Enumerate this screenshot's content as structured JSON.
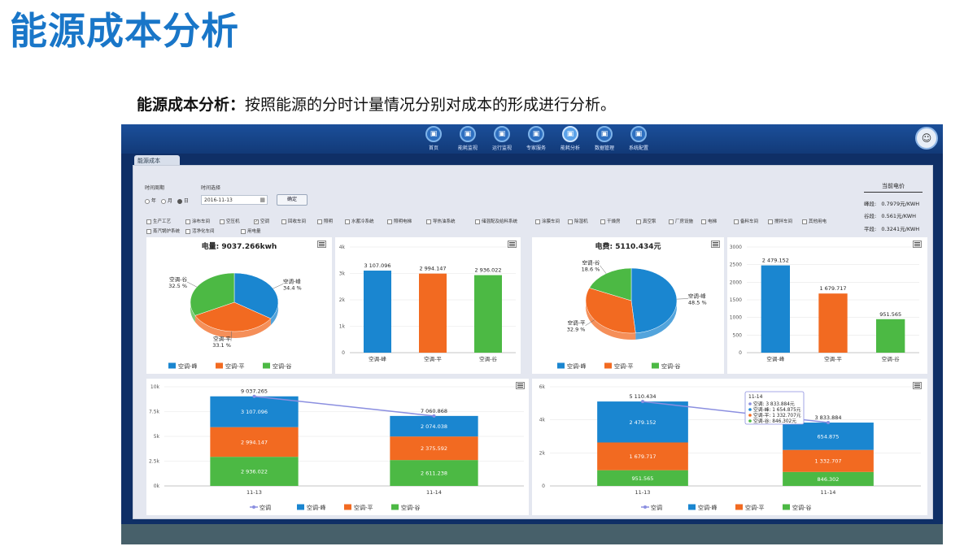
{
  "slide": {
    "title": "能源成本分析",
    "subtitle_bold": "能源成本分析",
    "subtitle_colon": "：",
    "subtitle_rest": "按照能源的分时计量情况分别对成本的形成进行分析。"
  },
  "nav": {
    "items": [
      {
        "label": "首页",
        "icon": "home-icon"
      },
      {
        "label": "能耗监视",
        "icon": "bar-chart-icon"
      },
      {
        "label": "运行监视",
        "icon": "gauge-icon"
      },
      {
        "label": "专家服务",
        "icon": "document-icon"
      },
      {
        "label": "能耗分析",
        "icon": "analysis-icon"
      },
      {
        "label": "数据管理",
        "icon": "data-icon"
      },
      {
        "label": "系统配置",
        "icon": "network-icon"
      }
    ],
    "active_index": 4
  },
  "tab": {
    "label": "能源成本"
  },
  "filters": {
    "period_label": "时间周期",
    "period_options": [
      "年",
      "月",
      "日"
    ],
    "period_selected": "日",
    "date_label": "时间选择",
    "date_value": "2016-11-13",
    "confirm_label": "确定"
  },
  "checkboxes": [
    {
      "label": "生产工艺",
      "checked": false
    },
    {
      "label": "涂布车间",
      "checked": false
    },
    {
      "label": "空压机",
      "checked": false
    },
    {
      "label": "空调",
      "checked": true
    },
    {
      "label": "回收车间",
      "checked": false
    },
    {
      "label": "照明",
      "checked": false
    },
    {
      "label": "水蓄冷系统",
      "checked": false
    },
    {
      "label": "照明电梯",
      "checked": false
    },
    {
      "label": "导热油系统",
      "checked": false
    },
    {
      "label": "储混配及给料系统",
      "checked": false
    },
    {
      "label": "涂膜车间",
      "checked": false
    },
    {
      "label": "除湿机",
      "checked": false
    },
    {
      "label": "干燥房",
      "checked": false
    },
    {
      "label": "真空泵",
      "checked": false
    },
    {
      "label": "厂房设施",
      "checked": false
    },
    {
      "label": "电梯",
      "checked": false
    },
    {
      "label": "备料车间",
      "checked": false
    },
    {
      "label": "搅拌车间",
      "checked": false
    },
    {
      "label": "其他用电",
      "checked": false
    },
    {
      "label": "蒸汽锅炉系统",
      "checked": false
    },
    {
      "label": "活净化车间",
      "checked": false
    },
    {
      "label": "用电量",
      "checked": false
    }
  ],
  "price": {
    "title": "当前电价",
    "rows": [
      {
        "label": "峰段:",
        "value": "0.7979元/KWH"
      },
      {
        "label": "谷段:",
        "value": "0.561元/KWH"
      },
      {
        "label": "平段:",
        "value": "0.3241元/KWH"
      }
    ]
  },
  "colors": {
    "peak": "#1a86d0",
    "flat": "#f26a21",
    "valley": "#4cb944",
    "line": "#8b8fe0"
  },
  "chart_data": [
    {
      "type": "pie",
      "title": "电量: 9037.266kwh",
      "slices": [
        {
          "name": "空调-峰",
          "value": 34.4,
          "label": "34.4 %"
        },
        {
          "name": "空调-平",
          "value": 33.1,
          "label": "33.1 %"
        },
        {
          "name": "空调-谷",
          "value": 32.5,
          "label": "32.5 %"
        }
      ],
      "legend": [
        "空调-峰",
        "空调-平",
        "空调-谷"
      ]
    },
    {
      "type": "bar",
      "categories": [
        "空调-峰",
        "空调-平",
        "空调-谷"
      ],
      "values": [
        3107.096,
        2994.147,
        2936.022
      ],
      "value_labels": [
        "3 107.096",
        "2 994.147",
        "2 936.022"
      ],
      "yticks": [
        "0",
        "1k",
        "2k",
        "3k",
        "4k"
      ],
      "ylim": [
        0,
        4000
      ]
    },
    {
      "type": "pie",
      "title": "电费: 5110.434元",
      "slices": [
        {
          "name": "空调-峰",
          "value": 48.5,
          "label": "48.5 %"
        },
        {
          "name": "空调-平",
          "value": 32.9,
          "label": "32.9 %"
        },
        {
          "name": "空调-谷",
          "value": 18.6,
          "label": "18.6 %"
        }
      ],
      "legend": [
        "空调-峰",
        "空调-平",
        "空调-谷"
      ]
    },
    {
      "type": "bar",
      "categories": [
        "空调-峰",
        "空调-平",
        "空调-谷"
      ],
      "values": [
        2479.152,
        1679.717,
        951.565
      ],
      "value_labels": [
        "2 479.152",
        "1 679.717",
        "951.565"
      ],
      "yticks": [
        "0",
        "500",
        "1000",
        "1500",
        "2000",
        "2500",
        "3000"
      ],
      "ylim": [
        0,
        3000
      ]
    },
    {
      "type": "bar",
      "stacked": true,
      "categories": [
        "11-13",
        "11-14"
      ],
      "series": [
        {
          "name": "空调-峰",
          "values": [
            3107.096,
            2074.038
          ],
          "labels": [
            "3 107.096",
            "2 074.038"
          ]
        },
        {
          "name": "空调-平",
          "values": [
            2994.147,
            2375.592
          ],
          "labels": [
            "2 994.147",
            "2 375.592"
          ]
        },
        {
          "name": "空调-谷",
          "values": [
            2936.022,
            2611.238
          ],
          "labels": [
            "2 936.022",
            "2 611.238"
          ]
        }
      ],
      "line": {
        "name": "空调",
        "values": [
          9037.265,
          7060.868
        ],
        "labels": [
          "9 037.265",
          "7 060.868"
        ]
      },
      "yticks": [
        "0k",
        "2.5k",
        "5k",
        "7.5k",
        "10k"
      ],
      "ylim": [
        0,
        10000
      ],
      "legend": [
        "空调",
        "空调-峰",
        "空调-平",
        "空调-谷"
      ]
    },
    {
      "type": "bar",
      "stacked": true,
      "categories": [
        "11-13",
        "11-14"
      ],
      "series": [
        {
          "name": "空调-峰",
          "values": [
            2479.152,
            1654.875
          ],
          "labels": [
            "2 479.152",
            "654.875"
          ]
        },
        {
          "name": "空调-平",
          "values": [
            1679.717,
            1332.707
          ],
          "labels": [
            "1 679.717",
            "1 332.707"
          ]
        },
        {
          "name": "空调-谷",
          "values": [
            951.565,
            846.302
          ],
          "labels": [
            "951.565",
            "846.302"
          ]
        }
      ],
      "line": {
        "name": "空调",
        "values": [
          5110.434,
          3833.884
        ],
        "labels": [
          "5 110.434",
          "3 833.884"
        ]
      },
      "yticks": [
        "0",
        "2k",
        "4k",
        "6k"
      ],
      "ylim": [
        0,
        6000
      ],
      "legend": [
        "空调",
        "空调-峰",
        "空调-平",
        "空调-谷"
      ],
      "tooltip": {
        "title": "11-14",
        "rows": [
          "空调: 3 833.884元",
          "空调-峰: 1 654.875元",
          "空调-平: 1 332.707元",
          "空调-谷: 846.302元"
        ]
      }
    }
  ]
}
